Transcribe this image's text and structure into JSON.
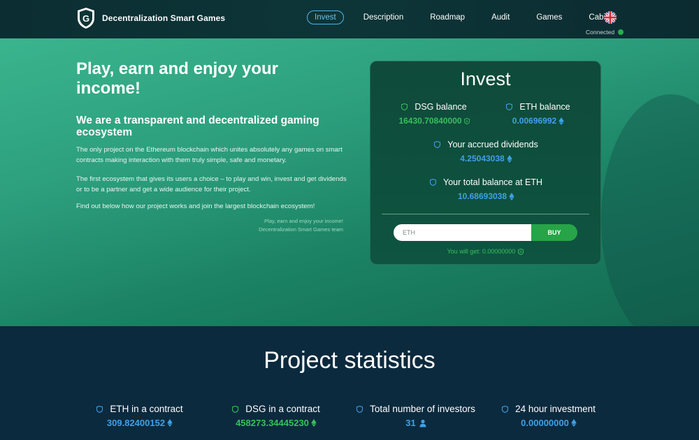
{
  "header": {
    "brand": "Decentralization Smart Games",
    "nav": [
      {
        "label": "Invest",
        "active": true
      },
      {
        "label": "Description"
      },
      {
        "label": "Roadmap"
      },
      {
        "label": "Audit"
      },
      {
        "label": "Games"
      },
      {
        "label": "Cabinet"
      }
    ],
    "language_icon": "uk-flag-icon",
    "status": "Connected",
    "status_color": "#23b04e"
  },
  "hero": {
    "title": "Play, earn and enjoy your income!",
    "subtitle": "We are a transparent and decentralized gaming ecosystem",
    "paragraphs": [
      "The only project on the Ethereum blockchain which unites absolutely any games on smart contracts making interaction with them truly simple, safe and monetary.",
      "The first ecosystem that gives its users a choice – to play and win, invest and get dividends or to be a partner and get a wide audience for their project.",
      "Find out below how our project works and join the largest blockchain ecosystem!"
    ],
    "signature_line1": "Play, earn and enjoy your income!",
    "signature_line2": "Decentralization Smart Games team"
  },
  "invest": {
    "title": "Invest",
    "dsg_balance_label": "DSG balance",
    "dsg_balance_value": "16430.70840000",
    "eth_balance_label": "ETH balance",
    "eth_balance_value": "0.00696992",
    "dividends_label": "Your accrued dividends",
    "dividends_value": "4.25043038",
    "total_label": "Your total balance at ETH",
    "total_value": "10.68693038",
    "input_placeholder": "ETH",
    "buy_label": "BUY",
    "you_get": "You will get: 0.00000000"
  },
  "statistics": {
    "title": "Project statistics",
    "items": [
      {
        "label": "ETH in a contract",
        "value": "309.82400152",
        "unit_icon": "eth-icon"
      },
      {
        "label": "DSG in a contract",
        "value": "458273.34445230",
        "unit_icon": "eth-icon"
      },
      {
        "label": "Total number of investors",
        "value": "31",
        "unit_icon": "user-icon"
      },
      {
        "label": "24 hour investment",
        "value": "0.00000000",
        "unit_icon": "eth-icon"
      }
    ]
  },
  "colors": {
    "accent_green": "#37c05c",
    "accent_blue": "#3ea1e7",
    "buy_button": "#27a447",
    "nav_active": "#4fb5ea"
  }
}
